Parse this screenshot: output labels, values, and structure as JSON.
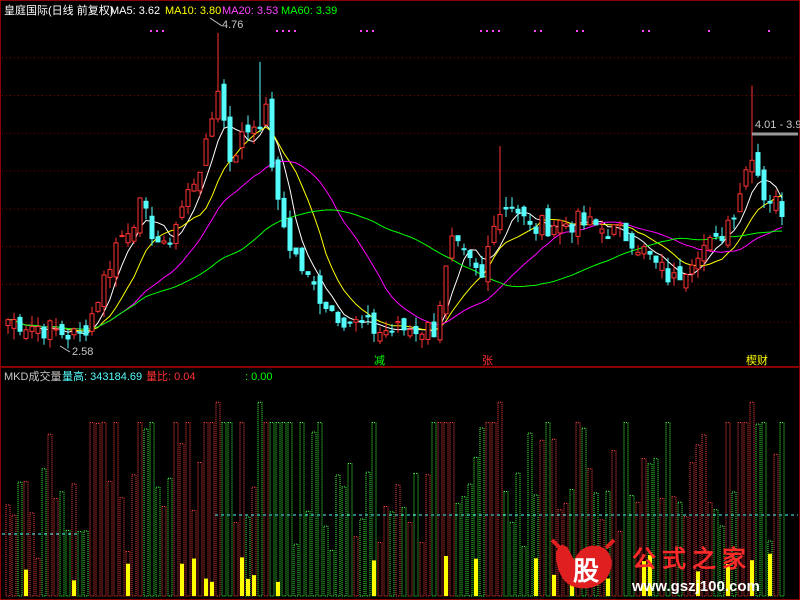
{
  "header": {
    "stock_name": "皇庭国际(日线 前复权)",
    "ma": [
      {
        "label": "MA5: 3.62",
        "color": "#ffffff"
      },
      {
        "label": "MA10: 3.80",
        "color": "#ffff00"
      },
      {
        "label": "MA20: 3.53",
        "color": "#ff00ff"
      },
      {
        "label": "MA60: 3.39",
        "color": "#00ff00"
      }
    ]
  },
  "volume_header": {
    "title": "MKD成交量",
    "vol_high_label": "量高: 343184.69",
    "vol_ratio_label": "量比: 0.04",
    "extra_label": ": 0.00"
  },
  "price_annotations": {
    "high_label": "4.76",
    "low_label": "2.58",
    "range_label": "4.01 - 3.9"
  },
  "signals": [
    {
      "label": "减",
      "color": "#00ff00",
      "index": 62
    },
    {
      "label": "张",
      "color": "#ff3030",
      "index": 80
    },
    {
      "label": "楔财",
      "color": "#ffff00",
      "index": 124
    }
  ],
  "watermark": {
    "logo_char": "股",
    "text": "公式之家",
    "url": "www.gszj100.com"
  },
  "colors": {
    "up": "#ff3232",
    "down": "#54fcfc",
    "vol_up": "#ff4040",
    "vol_down": "#40ff40",
    "vol_highlight": "#ffff00",
    "ma5": "#ffffff",
    "ma10": "#ffff00",
    "ma20": "#ff00ff",
    "ma60": "#00ff00",
    "grid": "#800000"
  },
  "chart_data": {
    "type": "candlestick",
    "price_range": [
      2.5,
      4.85
    ],
    "high_value": 4.76,
    "low_value": 2.58,
    "ma_values": {
      "MA5": 3.62,
      "MA10": 3.8,
      "MA20": 3.53,
      "MA60": 3.39
    },
    "close_anchors": [
      [
        0,
        2.78
      ],
      [
        8,
        2.7
      ],
      [
        12,
        2.66
      ],
      [
        14,
        2.82
      ],
      [
        18,
        3.3
      ],
      [
        22,
        3.55
      ],
      [
        26,
        3.25
      ],
      [
        30,
        3.65
      ],
      [
        33,
        3.95
      ],
      [
        35,
        4.4
      ],
      [
        37,
        3.9
      ],
      [
        40,
        4.1
      ],
      [
        43,
        4.2
      ],
      [
        45,
        3.55
      ],
      [
        47,
        3.3
      ],
      [
        50,
        3.05
      ],
      [
        54,
        2.85
      ],
      [
        58,
        2.75
      ],
      [
        62,
        2.7
      ],
      [
        67,
        2.72
      ],
      [
        71,
        2.72
      ],
      [
        74,
        3.3
      ],
      [
        77,
        3.15
      ],
      [
        79,
        3.05
      ],
      [
        81,
        3.5
      ],
      [
        84,
        3.6
      ],
      [
        87,
        3.4
      ],
      [
        91,
        3.45
      ],
      [
        95,
        3.45
      ],
      [
        100,
        3.4
      ],
      [
        104,
        3.35
      ],
      [
        108,
        3.15
      ],
      [
        111,
        3.05
      ],
      [
        115,
        3.28
      ],
      [
        118,
        3.3
      ],
      [
        121,
        3.55
      ],
      [
        124,
        3.95
      ],
      [
        126,
        3.65
      ],
      [
        129,
        3.55
      ]
    ],
    "spike_indices": [
      35,
      42,
      82,
      124
    ]
  }
}
